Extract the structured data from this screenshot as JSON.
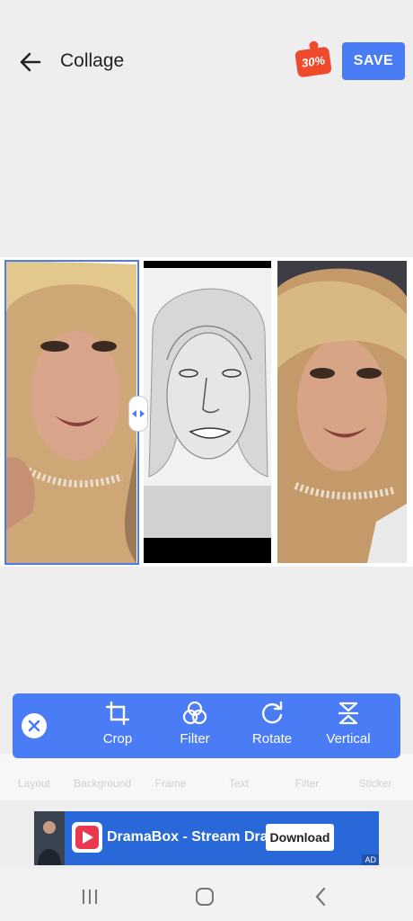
{
  "header": {
    "title": "Collage",
    "promo_badge": "30%",
    "save_label": "SAVE"
  },
  "toolbar": {
    "tools": [
      {
        "label": "Crop",
        "icon": "crop-icon"
      },
      {
        "label": "Filter",
        "icon": "filter-icon"
      },
      {
        "label": "Rotate",
        "icon": "rotate-icon"
      },
      {
        "label": "Vertical",
        "icon": "flip-vertical-icon"
      }
    ]
  },
  "bottom_menu": {
    "items": [
      "Layout",
      "Background",
      "Frame",
      "Text",
      "Filter",
      "Sticker"
    ]
  },
  "ad": {
    "text": "DramaBox - Stream Dra",
    "button": "Download",
    "tag": "AD"
  },
  "colors": {
    "accent": "#4a7df5",
    "background": "#eeeeee"
  }
}
